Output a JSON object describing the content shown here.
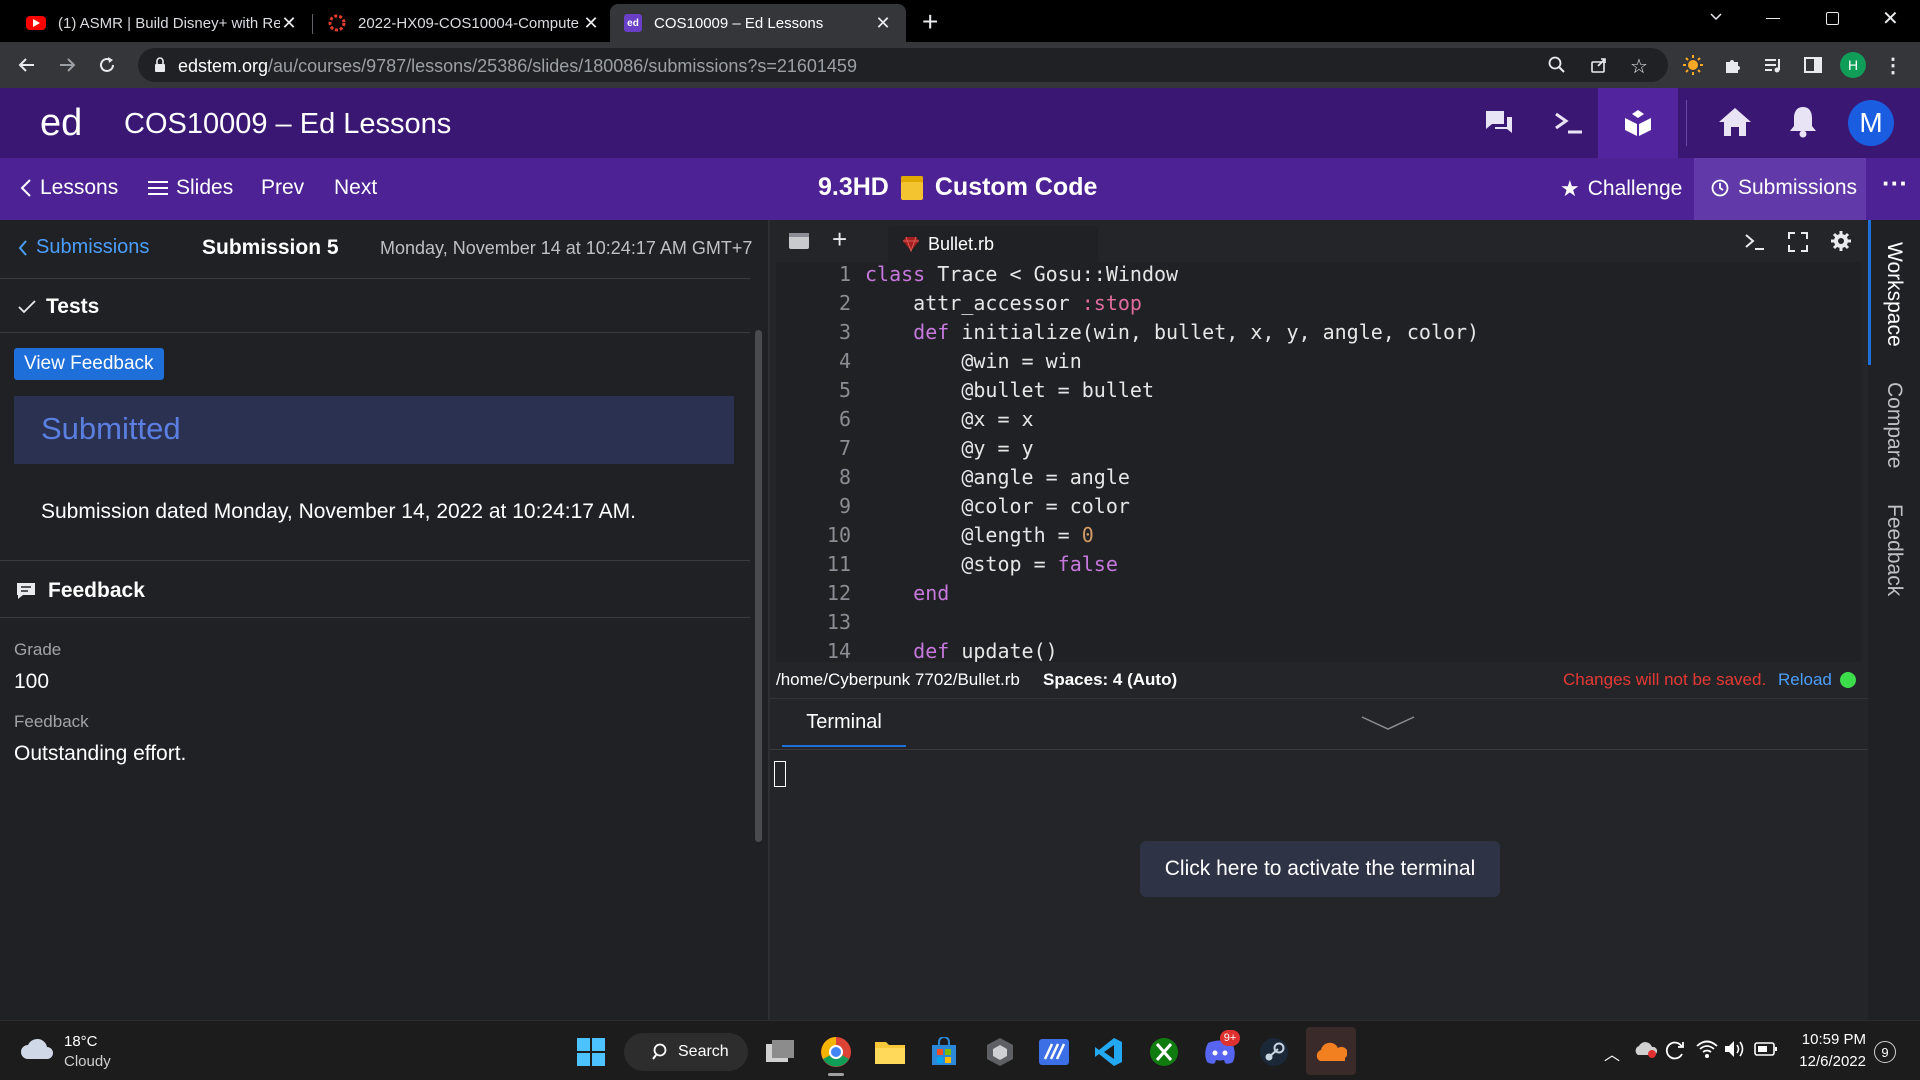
{
  "browser": {
    "tabs": [
      {
        "title": "(1) ASMR | Build Disney+ with Re",
        "icon": "youtube-icon"
      },
      {
        "title": "2022-HX09-COS10004-Compute",
        "icon": "canvas-icon"
      },
      {
        "title": "COS10009 – Ed Lessons",
        "icon": "ed-icon",
        "active": true
      }
    ],
    "url_host": "edstem.org",
    "url_path": "/au/courses/9787/lessons/25386/slides/180086/submissions?s=21601459",
    "profile_initial": "H"
  },
  "ed_header": {
    "logo": "ed",
    "title": "COS10009 – Ed Lessons",
    "avatar_initial": "M"
  },
  "lesson_nav": {
    "lessons": "Lessons",
    "slides": "Slides",
    "prev": "Prev",
    "next": "Next",
    "slide_number": "9.3HD",
    "slide_title": "Custom Code",
    "challenge": "Challenge",
    "submissions": "Submissions"
  },
  "submission": {
    "back_label": "Submissions",
    "title": "Submission 5",
    "date": "Monday, November 14 at 10:24:17 AM GMT+7",
    "tests_label": "Tests",
    "view_feedback": "View Feedback",
    "status": "Submitted",
    "dated_text": "Submission dated Monday, November 14, 2022 at 10:24:17 AM.",
    "feedback_heading": "Feedback",
    "grade_label": "Grade",
    "grade_value": "100",
    "feedback_label": "Feedback",
    "feedback_text": "Outstanding effort."
  },
  "editor": {
    "file_tab": "Bullet.rb",
    "line_numbers": [
      "1",
      "2",
      "3",
      "4",
      "5",
      "6",
      "7",
      "8",
      "9",
      "10",
      "11",
      "12",
      "13",
      "14"
    ],
    "status_path": "/home/Cyberpunk 7702/Bullet.rb",
    "status_spaces": "Spaces: 4 (Auto)",
    "unsaved_warning": "Changes will not be saved.",
    "reload": "Reload",
    "terminal_tab": "Terminal",
    "terminal_activate": "Click here to activate the terminal"
  },
  "right_rail": {
    "workspace": "Workspace",
    "compare": "Compare",
    "feedback": "Feedback"
  },
  "taskbar": {
    "weather_temp": "18°C",
    "weather_cond": "Cloudy",
    "search": "Search",
    "time": "10:59 PM",
    "date": "12/6/2022",
    "discord_badge": "9+",
    "notif_count": "9"
  },
  "colors": {
    "ed_header": "#3b1774",
    "lesson_nav": "#4d2294",
    "view_feedback_button": "#1e6fd9",
    "submitted_text": "#5b7fe0",
    "warning_red": "#e53935",
    "reload_blue": "#4a9eff",
    "keyword_purple": "#c678dd"
  }
}
